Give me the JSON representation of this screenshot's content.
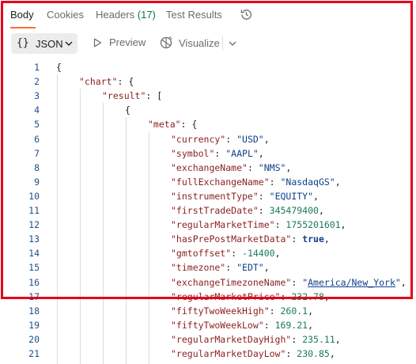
{
  "tabs": [
    {
      "label": "Body",
      "active": true
    },
    {
      "label": "Cookies"
    },
    {
      "label": "Headers",
      "count": "(17)"
    },
    {
      "label": "Test Results"
    }
  ],
  "toolbar": {
    "format_label": "JSON",
    "preview_label": "Preview",
    "visualize_label": "Visualize"
  },
  "colors": {
    "accent": "#ff6c37",
    "highlight_border": "#e3001b",
    "count_green": "#0c7b3a"
  },
  "code_lines": [
    {
      "n": "1",
      "indent": 0,
      "parts": [
        [
          "pun",
          "{"
        ]
      ]
    },
    {
      "n": "2",
      "indent": 1,
      "parts": [
        [
          "key",
          "\"chart\""
        ],
        [
          "pun",
          ": {"
        ]
      ]
    },
    {
      "n": "3",
      "indent": 2,
      "parts": [
        [
          "key",
          "\"result\""
        ],
        [
          "pun",
          ": ["
        ]
      ]
    },
    {
      "n": "4",
      "indent": 3,
      "parts": [
        [
          "pun",
          "{"
        ]
      ]
    },
    {
      "n": "5",
      "indent": 4,
      "parts": [
        [
          "key",
          "\"meta\""
        ],
        [
          "pun",
          ": {"
        ]
      ]
    },
    {
      "n": "6",
      "indent": 5,
      "parts": [
        [
          "key",
          "\"currency\""
        ],
        [
          "pun",
          ": "
        ],
        [
          "str",
          "\"USD\""
        ],
        [
          "pun",
          ","
        ]
      ]
    },
    {
      "n": "7",
      "indent": 5,
      "parts": [
        [
          "key",
          "\"symbol\""
        ],
        [
          "pun",
          ": "
        ],
        [
          "str",
          "\"AAPL\""
        ],
        [
          "pun",
          ","
        ]
      ]
    },
    {
      "n": "8",
      "indent": 5,
      "parts": [
        [
          "key",
          "\"exchangeName\""
        ],
        [
          "pun",
          ": "
        ],
        [
          "str",
          "\"NMS\""
        ],
        [
          "pun",
          ","
        ]
      ]
    },
    {
      "n": "9",
      "indent": 5,
      "parts": [
        [
          "key",
          "\"fullExchangeName\""
        ],
        [
          "pun",
          ": "
        ],
        [
          "str",
          "\"NasdaqGS\""
        ],
        [
          "pun",
          ","
        ]
      ]
    },
    {
      "n": "10",
      "indent": 5,
      "parts": [
        [
          "key",
          "\"instrumentType\""
        ],
        [
          "pun",
          ": "
        ],
        [
          "str",
          "\"EQUITY\""
        ],
        [
          "pun",
          ","
        ]
      ]
    },
    {
      "n": "11",
      "indent": 5,
      "parts": [
        [
          "key",
          "\"firstTradeDate\""
        ],
        [
          "pun",
          ": "
        ],
        [
          "num",
          "345479400"
        ],
        [
          "pun",
          ","
        ]
      ]
    },
    {
      "n": "12",
      "indent": 5,
      "parts": [
        [
          "key",
          "\"regularMarketTime\""
        ],
        [
          "pun",
          ": "
        ],
        [
          "num",
          "1755201601"
        ],
        [
          "pun",
          ","
        ]
      ]
    },
    {
      "n": "13",
      "indent": 5,
      "parts": [
        [
          "key",
          "\"hasPrePostMarketData\""
        ],
        [
          "pun",
          ": "
        ],
        [
          "kw",
          "true"
        ],
        [
          "pun",
          ","
        ]
      ]
    },
    {
      "n": "14",
      "indent": 5,
      "parts": [
        [
          "key",
          "\"gmtoffset\""
        ],
        [
          "pun",
          ": "
        ],
        [
          "num",
          "-14400"
        ],
        [
          "pun",
          ","
        ]
      ]
    },
    {
      "n": "15",
      "indent": 5,
      "parts": [
        [
          "key",
          "\"timezone\""
        ],
        [
          "pun",
          ": "
        ],
        [
          "str",
          "\"EDT\""
        ],
        [
          "pun",
          ","
        ]
      ]
    },
    {
      "n": "16",
      "indent": 5,
      "parts": [
        [
          "key",
          "\"exchangeTimezoneName\""
        ],
        [
          "pun",
          ": "
        ],
        [
          "str",
          "\""
        ],
        [
          "link",
          "America/New_York"
        ],
        [
          "str",
          "\""
        ],
        [
          "pun",
          ","
        ]
      ]
    },
    {
      "n": "17",
      "indent": 5,
      "parts": [
        [
          "key",
          "\"regularMarketPrice\""
        ],
        [
          "pun",
          ": "
        ],
        [
          "num",
          "232.78"
        ],
        [
          "pun",
          ","
        ]
      ]
    },
    {
      "n": "18",
      "indent": 5,
      "parts": [
        [
          "key",
          "\"fiftyTwoWeekHigh\""
        ],
        [
          "pun",
          ": "
        ],
        [
          "num",
          "260.1"
        ],
        [
          "pun",
          ","
        ]
      ]
    },
    {
      "n": "19",
      "indent": 5,
      "parts": [
        [
          "key",
          "\"fiftyTwoWeekLow\""
        ],
        [
          "pun",
          ": "
        ],
        [
          "num",
          "169.21"
        ],
        [
          "pun",
          ","
        ]
      ]
    },
    {
      "n": "20",
      "indent": 5,
      "parts": [
        [
          "key",
          "\"regularMarketDayHigh\""
        ],
        [
          "pun",
          ": "
        ],
        [
          "num",
          "235.11"
        ],
        [
          "pun",
          ","
        ]
      ]
    },
    {
      "n": "21",
      "indent": 5,
      "parts": [
        [
          "key",
          "\"regularMarketDayLow\""
        ],
        [
          "pun",
          ": "
        ],
        [
          "num",
          "230.85"
        ],
        [
          "pun",
          ","
        ]
      ]
    }
  ]
}
